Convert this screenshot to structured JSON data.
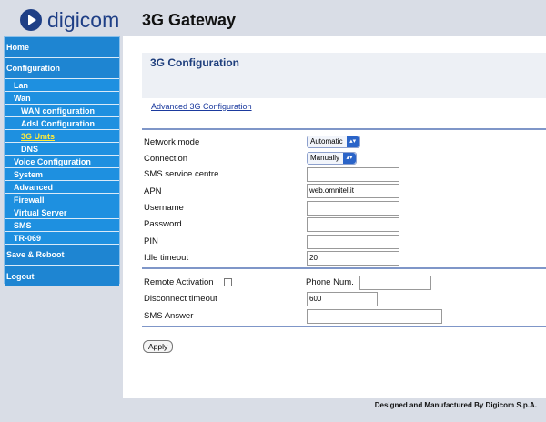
{
  "brand": {
    "logo_text": "digicom"
  },
  "app_title": "3G Gateway",
  "sidebar": {
    "items": [
      {
        "label": "Home"
      },
      {
        "label": "Configuration"
      },
      {
        "label": "Lan"
      },
      {
        "label": "Wan"
      },
      {
        "label": "WAN configuration"
      },
      {
        "label": "Adsl Configuration"
      },
      {
        "label": "3G Umts"
      },
      {
        "label": "DNS"
      },
      {
        "label": "Voice Configuration"
      },
      {
        "label": "System"
      },
      {
        "label": "Advanced"
      },
      {
        "label": "Firewall"
      },
      {
        "label": "Virtual Server"
      },
      {
        "label": "SMS"
      },
      {
        "label": "TR-069"
      },
      {
        "label": "Save & Reboot"
      },
      {
        "label": "Logout"
      }
    ]
  },
  "main": {
    "title": "3G Configuration",
    "advanced_link": "Advanced 3G Configuration",
    "fields": {
      "network_mode_label": "Network mode",
      "network_mode_value": "Automatic",
      "connection_label": "Connection",
      "connection_value": "Manually",
      "sms_centre_label": "SMS service centre",
      "sms_centre_value": "",
      "apn_label": "APN",
      "apn_value": "web.omnitel.it",
      "username_label": "Username",
      "username_value": "",
      "password_label": "Password",
      "password_value": "",
      "pin_label": "PIN",
      "pin_value": "",
      "idle_timeout_label": "Idle timeout",
      "idle_timeout_value": "20",
      "remote_activation_label": "Remote Activation",
      "phone_num_label": "Phone Num.",
      "phone_num_value": "",
      "disconnect_timeout_label": "Disconnect timeout",
      "disconnect_timeout_value": "600",
      "sms_answer_label": "SMS Answer",
      "sms_answer_value": ""
    },
    "apply_label": "Apply"
  },
  "footer": "Designed and Manufactured By Digicom S.p.A."
}
